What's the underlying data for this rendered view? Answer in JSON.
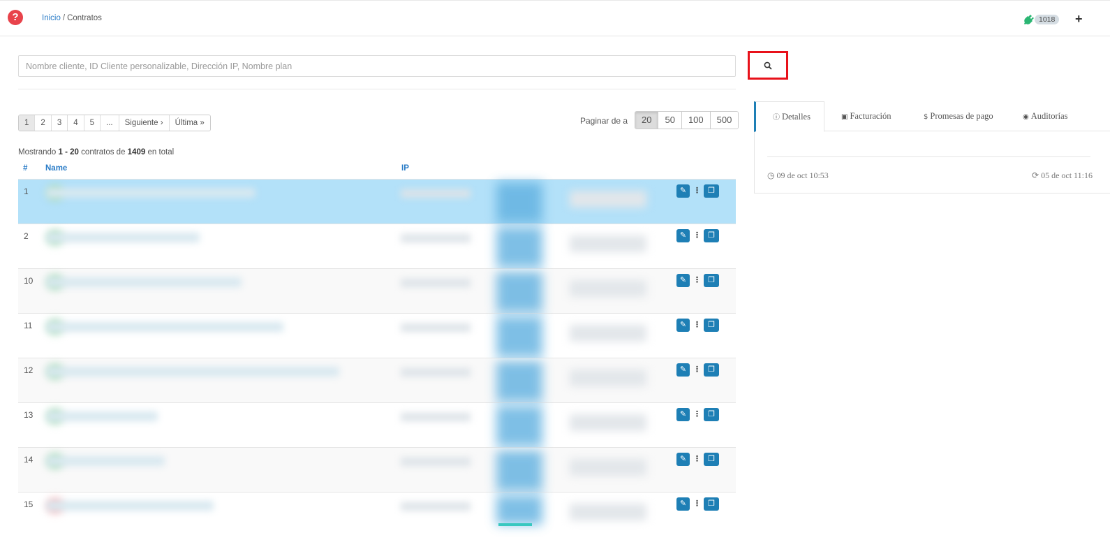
{
  "header": {
    "breadcrumb_home": "Inicio",
    "breadcrumb_sep": "/",
    "breadcrumb_current": "Contratos",
    "badge_count": "1018",
    "help_icon": "question-circle-icon",
    "plug_icon": "plug-icon",
    "plus_icon": "plus-icon"
  },
  "search": {
    "placeholder": "Nombre cliente, ID Cliente personalizable, Dirección IP, Nombre plan",
    "value": "",
    "button_icon": "search-icon"
  },
  "pagination": {
    "pages": [
      "1",
      "2",
      "3",
      "4",
      "5",
      "..."
    ],
    "next": "Siguiente ›",
    "last": "Última »",
    "active_page": "1"
  },
  "per_page": {
    "label": "Paginar de a",
    "options": [
      "20",
      "50",
      "100",
      "500"
    ],
    "active": "20"
  },
  "summary": {
    "prefix": "Mostrando",
    "range": "1 - 20",
    "middle": "contratos de",
    "total": "1409",
    "suffix": "en total"
  },
  "table": {
    "headers": {
      "num": "#",
      "name": "Name",
      "ip": "IP"
    },
    "rows": [
      {
        "num": "1",
        "selected": true
      },
      {
        "num": "2"
      },
      {
        "num": "10"
      },
      {
        "num": "11"
      },
      {
        "num": "12"
      },
      {
        "num": "13"
      },
      {
        "num": "14"
      },
      {
        "num": "15"
      }
    ],
    "row_icons": {
      "edit": "pencil-icon",
      "menu": "kebab-menu-icon",
      "copy": "copy-icon"
    }
  },
  "details_panel": {
    "tabs": [
      {
        "label": "Detalles",
        "icon": "info-circle-icon",
        "active": true
      },
      {
        "label": "Facturación",
        "icon": "money-icon"
      },
      {
        "label": "Promesas de pago",
        "icon": "dollar-icon"
      },
      {
        "label": "Auditorías",
        "icon": "eye-icon"
      }
    ],
    "created": "09 de oct 10:53",
    "updated": "05 de oct 11:16"
  },
  "colors": {
    "accent": "#2a7cc7",
    "button": "#1e7fb5",
    "selected_row": "#b3e1f9",
    "highlight_border": "#e8111a",
    "help": "#e8434b"
  }
}
